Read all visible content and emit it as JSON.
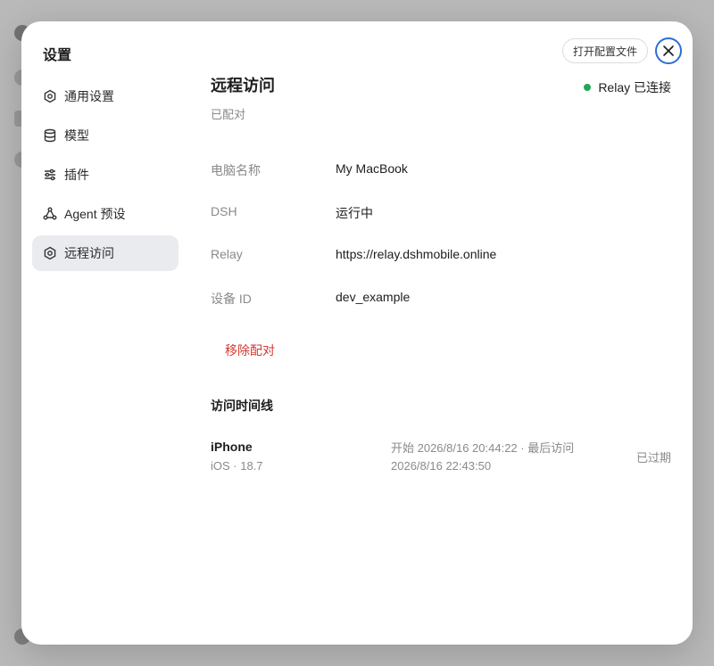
{
  "modal": {
    "title": "设置",
    "open_config_label": "打开配置文件"
  },
  "sidebar": {
    "items": [
      {
        "label": "通用设置",
        "icon": "gear-icon"
      },
      {
        "label": "模型",
        "icon": "database-icon"
      },
      {
        "label": "插件",
        "icon": "sliders-icon"
      },
      {
        "label": "Agent 预设",
        "icon": "agent-icon"
      },
      {
        "label": "远程访问",
        "icon": "gear-icon",
        "active": true
      }
    ]
  },
  "page": {
    "title": "远程访问",
    "subtitle": "已配对",
    "relay_status": "Relay 已连接",
    "status_color": "#22a55b"
  },
  "info": [
    {
      "key": "电脑名称",
      "value": "My MacBook"
    },
    {
      "key": "DSH",
      "value": "运行中"
    },
    {
      "key": "Relay",
      "value": "https://relay.dshmobile.online"
    },
    {
      "key": "设备 ID",
      "value": "dev_example"
    }
  ],
  "remove_label": "移除配对",
  "timeline": {
    "title": "访问时间线",
    "entries": [
      {
        "device": "iPhone",
        "os": "iOS · 18.7",
        "time_line1": "开始 2026/8/16 20:44:22 · 最后访问",
        "time_line2": "2026/8/16 22:43:50",
        "status": "已过期"
      }
    ]
  }
}
